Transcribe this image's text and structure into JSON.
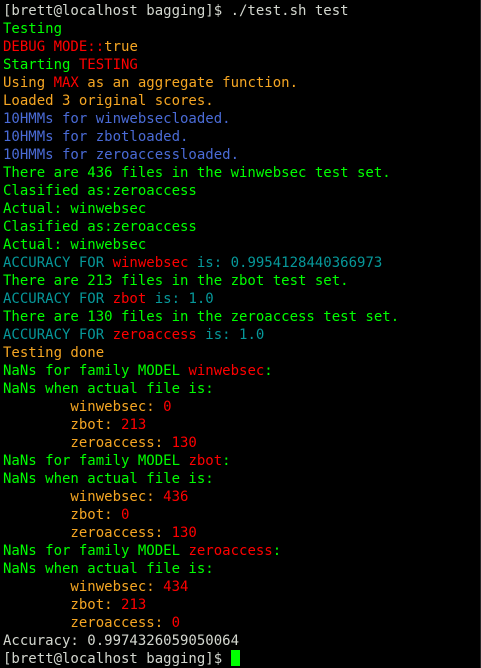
{
  "colors": {
    "prompt": "#d3d7cf",
    "green": "#00ff00",
    "red": "#ff0000",
    "orange": "#f5a623",
    "blue": "#4a6bd6",
    "cyan": "#06989a",
    "cursor": "#00ff00"
  },
  "terminal": {
    "lines": [
      [
        {
          "t": "[brett@localhost bagging]$ ./test.sh test",
          "c": "prompt"
        }
      ],
      [
        {
          "t": "Testing",
          "c": "green"
        }
      ],
      [
        {
          "t": "DEBUG MODE::",
          "c": "red"
        },
        {
          "t": "true",
          "c": "orange"
        }
      ],
      [
        {
          "t": "Starting ",
          "c": "green"
        },
        {
          "t": "TESTING",
          "c": "red"
        }
      ],
      [
        {
          "t": "Using ",
          "c": "orange"
        },
        {
          "t": "MAX",
          "c": "red"
        },
        {
          "t": " as an aggregate function.",
          "c": "orange"
        }
      ],
      [
        {
          "t": "Loaded 3 original scores.",
          "c": "orange"
        }
      ],
      [
        {
          "t": "10HMMs for winwebsecloaded.",
          "c": "blue"
        }
      ],
      [
        {
          "t": "10HMMs for zbotloaded.",
          "c": "blue"
        }
      ],
      [
        {
          "t": "10HMMs for zeroaccessloaded.",
          "c": "blue"
        }
      ],
      [
        {
          "t": "There are 436 files in the winwebsec test set.",
          "c": "green"
        }
      ],
      [
        {
          "t": "Clasified as:zeroaccess",
          "c": "green"
        }
      ],
      [
        {
          "t": "Actual: winwebsec",
          "c": "green"
        }
      ],
      [
        {
          "t": "Clasified as:zeroaccess",
          "c": "green"
        }
      ],
      [
        {
          "t": "Actual: winwebsec",
          "c": "green"
        }
      ],
      [
        {
          "t": "ACCURACY FOR ",
          "c": "cyan"
        },
        {
          "t": "winwebsec",
          "c": "red"
        },
        {
          "t": " is: 0.9954128440366973",
          "c": "cyan"
        }
      ],
      [
        {
          "t": "There are 213 files in the zbot test set.",
          "c": "green"
        }
      ],
      [
        {
          "t": "ACCURACY FOR ",
          "c": "cyan"
        },
        {
          "t": "zbot",
          "c": "red"
        },
        {
          "t": " is: 1.0",
          "c": "cyan"
        }
      ],
      [
        {
          "t": "There are 130 files in the zeroaccess test set.",
          "c": "green"
        }
      ],
      [
        {
          "t": "ACCURACY FOR ",
          "c": "cyan"
        },
        {
          "t": "zeroaccess",
          "c": "red"
        },
        {
          "t": " is: 1.0",
          "c": "cyan"
        }
      ],
      [
        {
          "t": "Testing done",
          "c": "orange"
        }
      ],
      [
        {
          "t": "NaNs for family MODEL ",
          "c": "green"
        },
        {
          "t": "winwebsec",
          "c": "red"
        },
        {
          "t": ":",
          "c": "green"
        }
      ],
      [
        {
          "t": "NaNs when actual file is:",
          "c": "green"
        }
      ],
      [
        {
          "t": "        winwebsec: ",
          "c": "orange"
        },
        {
          "t": "0",
          "c": "red"
        }
      ],
      [
        {
          "t": "        zbot: ",
          "c": "orange"
        },
        {
          "t": "213",
          "c": "red"
        }
      ],
      [
        {
          "t": "        zeroaccess: ",
          "c": "orange"
        },
        {
          "t": "130",
          "c": "red"
        }
      ],
      [
        {
          "t": "NaNs for family MODEL ",
          "c": "green"
        },
        {
          "t": "zbot",
          "c": "red"
        },
        {
          "t": ":",
          "c": "green"
        }
      ],
      [
        {
          "t": "NaNs when actual file is:",
          "c": "green"
        }
      ],
      [
        {
          "t": "        winwebsec: ",
          "c": "orange"
        },
        {
          "t": "436",
          "c": "red"
        }
      ],
      [
        {
          "t": "        zbot: ",
          "c": "orange"
        },
        {
          "t": "0",
          "c": "red"
        }
      ],
      [
        {
          "t": "        zeroaccess: ",
          "c": "orange"
        },
        {
          "t": "130",
          "c": "red"
        }
      ],
      [
        {
          "t": "NaNs for family MODEL ",
          "c": "green"
        },
        {
          "t": "zeroaccess",
          "c": "red"
        },
        {
          "t": ":",
          "c": "green"
        }
      ],
      [
        {
          "t": "NaNs when actual file is:",
          "c": "green"
        }
      ],
      [
        {
          "t": "        winwebsec: ",
          "c": "orange"
        },
        {
          "t": "434",
          "c": "red"
        }
      ],
      [
        {
          "t": "        zbot: ",
          "c": "orange"
        },
        {
          "t": "213",
          "c": "red"
        }
      ],
      [
        {
          "t": "        zeroaccess: ",
          "c": "orange"
        },
        {
          "t": "0",
          "c": "red"
        }
      ],
      [
        {
          "t": "Accuracy: 0.9974326059050064",
          "c": "prompt"
        }
      ],
      [
        {
          "t": "[brett@localhost bagging]$ ",
          "c": "prompt"
        }
      ]
    ],
    "cursor_icon": "block-cursor-icon"
  }
}
